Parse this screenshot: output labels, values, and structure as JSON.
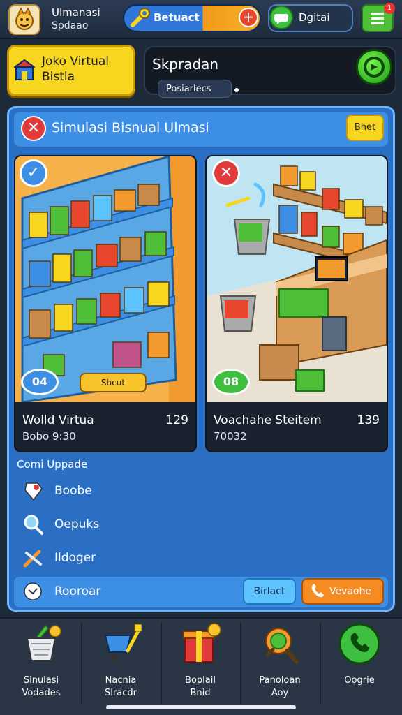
{
  "app": {
    "title": "Ulmanasi",
    "subtitle": "Spdaao"
  },
  "topbar": {
    "resource_label": "Betuact",
    "add_symbol": "+",
    "chat_label": "Dgitai",
    "notification_count": "1"
  },
  "header": {
    "store_button": {
      "line1": "Joko Virtual",
      "line2": "Bistla"
    },
    "sim_title": "Skpradan",
    "sim_tab": "Posiarlecs"
  },
  "panel": {
    "title": "Simulasi Bisnual Ulmasi",
    "close_symbol": "✕",
    "top_right_button": "Bhet",
    "cards": [
      {
        "status_symbol": "✓",
        "title": "Wolld Virtua",
        "price": "129",
        "meta": "Bobo 9:30",
        "count_badge": "04",
        "tag": "Shcut"
      },
      {
        "status_symbol": "✕",
        "title": "Voachahe Steitem",
        "price": "139",
        "meta": "70032",
        "count_badge": "08"
      }
    ],
    "list_heading": "Comi Uppade",
    "list_items": [
      {
        "label": "Boobe",
        "icon": "pin-icon"
      },
      {
        "label": "Oepuks",
        "icon": "search-icon"
      },
      {
        "label": "Ildoger",
        "icon": "tools-icon"
      },
      {
        "label": "Rooroar",
        "icon": "chat-bubble-icon"
      }
    ],
    "actions": {
      "primary": "Birlact",
      "secondary": "Vevaohe"
    }
  },
  "bottom_nav": [
    {
      "line1": "Sinulasi",
      "line2": "Vodades",
      "icon": "basket-icon"
    },
    {
      "line1": "Nacnia",
      "line2": "Slracdr",
      "icon": "wheelbarrow-icon"
    },
    {
      "line1": "Boplail",
      "line2": "Bnid",
      "icon": "gift-box-icon"
    },
    {
      "line1": "Panoloan",
      "line2": "Aoy",
      "icon": "magnifier-icon"
    },
    {
      "line1": "Oogrie",
      "line2": "",
      "icon": "phone-icon"
    }
  ],
  "colors": {
    "panel_blue": "#2b6fc4",
    "accent_yellow": "#f7d61f",
    "accent_green": "#3fbf3f",
    "accent_red": "#e03a3a",
    "accent_orange": "#f68b22"
  }
}
